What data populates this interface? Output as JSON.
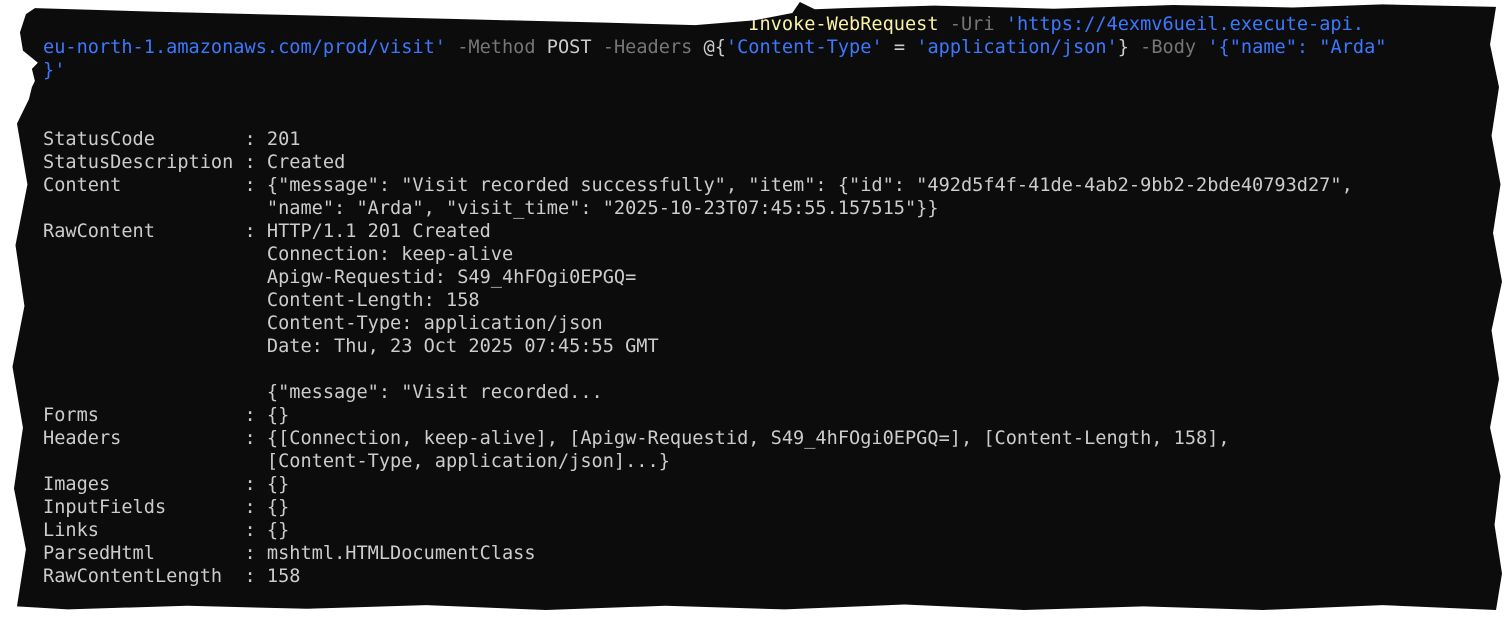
{
  "window": {
    "title": "",
    "background_color": "#0c0c0c",
    "text_color": "#cccccc",
    "command_color": "#f9f1a5",
    "parameter_color": "#767676",
    "string_color": "#3b78ff"
  },
  "command": {
    "cmdlet": "Invoke-WebRequest",
    "uri_flag": "-Uri",
    "uri_part1": "'https://4exmv6ueil.execute-api.",
    "uri_part2": "eu-north-1.amazonaws.com/prod/visit'",
    "method_flag": "-Method",
    "method_value": "POST",
    "headers_flag": "-Headers",
    "headers_open": "@{",
    "header_key": "'Content-Type'",
    "header_eq": " = ",
    "header_value": "'application/json'",
    "headers_close": "}",
    "body_flag": "-Body",
    "body_part1": "'{\"name\": \"Arda\"",
    "body_part2": "}'"
  },
  "output": {
    "status_code_label": "StatusCode",
    "status_code_value": "201",
    "status_description_label": "StatusDescription",
    "status_description_value": "Created",
    "content_label": "Content",
    "content_line1": "{\"message\": \"Visit recorded successfully\", \"item\": {\"id\": \"492d5f4f-41de-4ab2-9bb2-2bde40793d27\",",
    "content_line2": "\"name\": \"Arda\", \"visit_time\": \"2025-10-23T07:45:55.157515\"}}",
    "raw_content_label": "RawContent",
    "raw_content_lines": [
      "HTTP/1.1 201 Created",
      "Connection: keep-alive",
      "Apigw-Requestid: S49_4hFOgi0EPGQ=",
      "Content-Length: 158",
      "Content-Type: application/json",
      "Date: Thu, 23 Oct 2025 07:45:55 GMT",
      "",
      "{\"message\": \"Visit recorded..."
    ],
    "forms_label": "Forms",
    "forms_value": "{}",
    "headers_label": "Headers",
    "headers_line1": "{[Connection, keep-alive], [Apigw-Requestid, S49_4hFOgi0EPGQ=], [Content-Length, 158],",
    "headers_line2": "[Content-Type, application/json]...}",
    "images_label": "Images",
    "images_value": "{}",
    "input_fields_label": "InputFields",
    "input_fields_value": "{}",
    "links_label": "Links",
    "links_value": "{}",
    "parsed_html_label": "ParsedHtml",
    "parsed_html_value": "mshtml.HTMLDocumentClass",
    "raw_content_length_label": "RawContentLength",
    "raw_content_length_value": "158",
    "separator": " : "
  }
}
